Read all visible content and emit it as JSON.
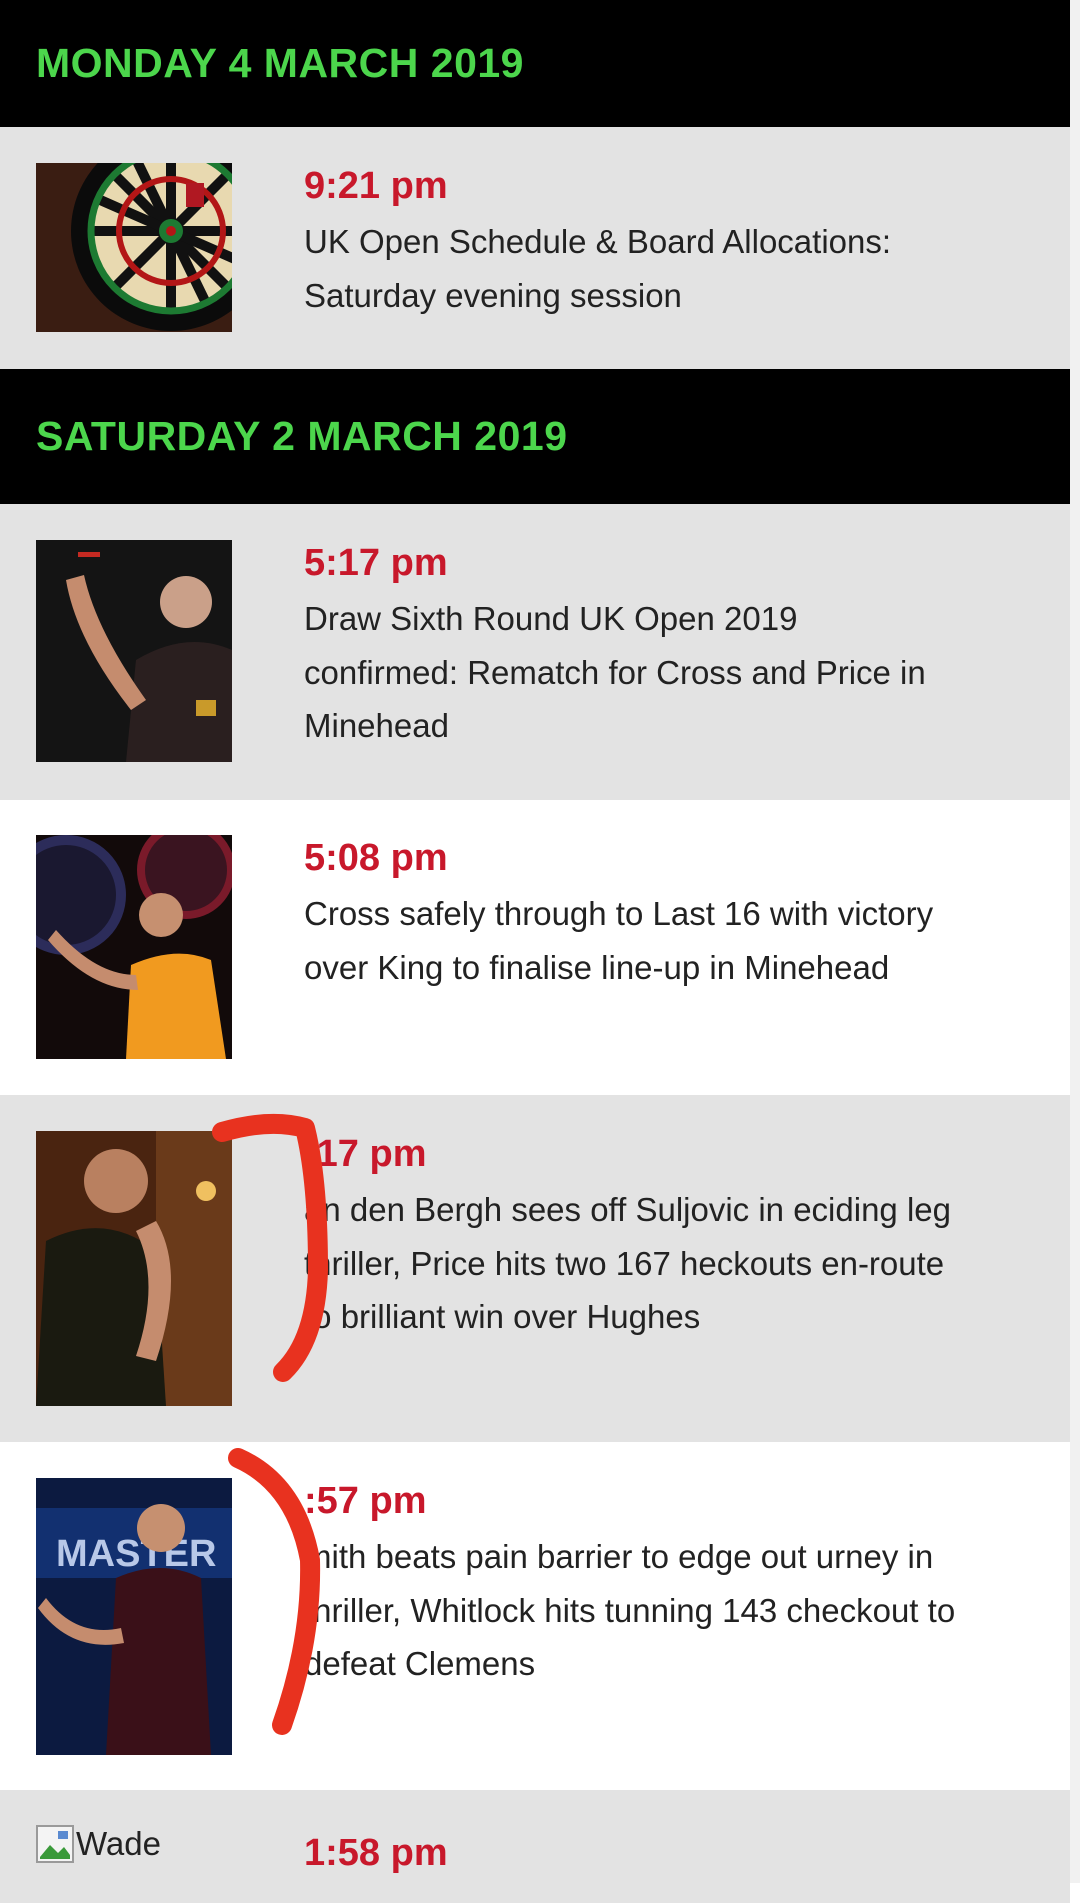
{
  "sections": [
    {
      "date": "MONDAY 4 MARCH 2019",
      "items": [
        {
          "time": "9:21 pm",
          "headline": "UK Open Schedule & Board Allocations: Saturday evening session",
          "thumb_icon": "dartboard-icon"
        }
      ]
    },
    {
      "date": "SATURDAY 2 MARCH 2019",
      "items": [
        {
          "time": "5:17 pm",
          "headline": "Draw Sixth Round UK Open 2019 confirmed: Rematch for Cross and Price in Minehead",
          "thumb_icon": "darts-player-photo"
        },
        {
          "time": "5:08 pm",
          "headline": "Cross safely through to Last 16 with victory over King to finalise line-up in Minehead",
          "thumb_icon": "darts-player-photo"
        },
        {
          "time": ":17 pm",
          "headline": "an den Bergh sees off Suljovic in eciding leg thriller, Price hits two 167 heckouts en-route to brilliant win over Hughes",
          "thumb_icon": "darts-player-photo"
        },
        {
          "time": ":57 pm",
          "headline": "mith beats pain barrier to edge out urney in thriller, Whitlock hits tunning 143 checkout to defeat Clemens",
          "thumb_icon": "darts-player-photo"
        },
        {
          "time": "1:58 pm",
          "headline": "",
          "thumb_alt": "Wade",
          "thumb_icon": "broken-image-icon"
        }
      ]
    }
  ],
  "colors": {
    "header_bg": "#000000",
    "header_text": "#4cd64c",
    "time_text": "#c8182b",
    "row_gray": "#e3e3e3",
    "row_white": "#ffffff",
    "annotation": "#e8321f"
  }
}
